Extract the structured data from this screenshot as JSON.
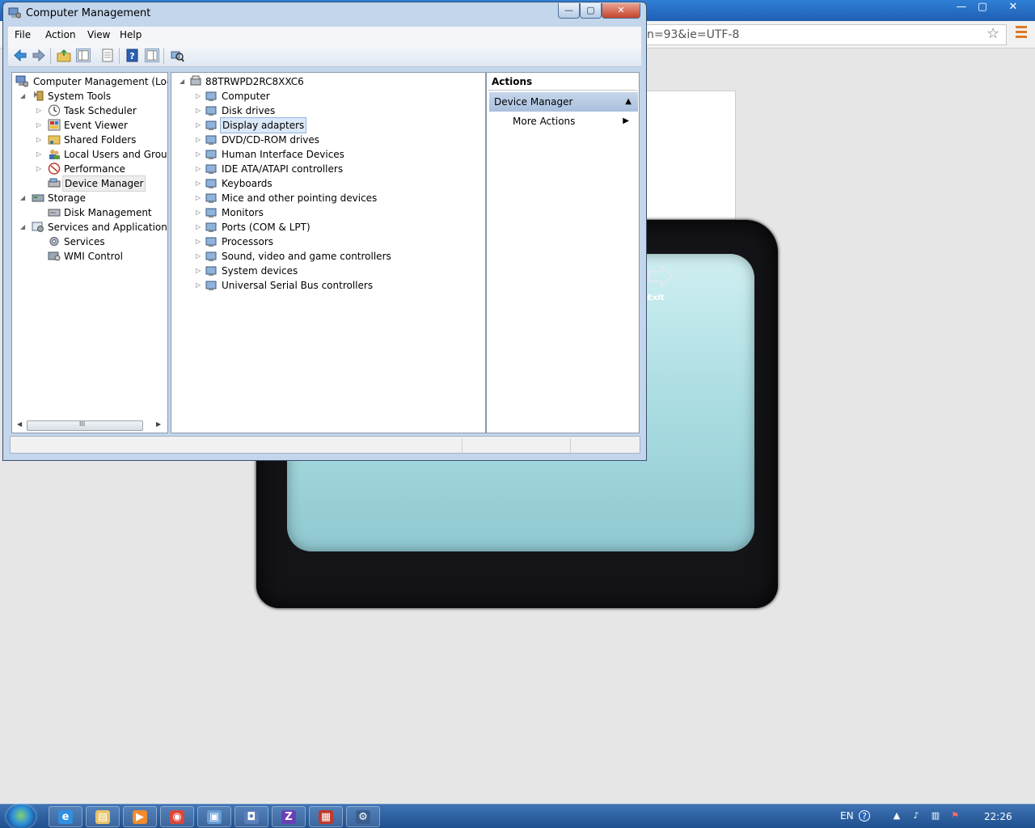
{
  "browser": {
    "address_text": "n=93&ie=UTF-8",
    "minimize_glyph": "—",
    "restore_glyph": "▢",
    "close_glyph": "✕",
    "bookmark_glyph": "☆",
    "exit_label": "Exit"
  },
  "window": {
    "title": "Computer Management",
    "minimize_glyph": "—",
    "maximize_glyph": "▢",
    "close_glyph": "✕"
  },
  "menu": [
    "File",
    "Action",
    "View",
    "Help"
  ],
  "toolbar_icons": [
    "back-icon",
    "forward-icon",
    "up-folder-icon",
    "show-hide-tree-icon",
    "properties-icon",
    "help-icon",
    "show-hide-action-pane-icon",
    "scan-hardware-icon"
  ],
  "left_tree": [
    {
      "label": "Computer Management (Local",
      "icon": "computer-management-icon",
      "tri": ""
    },
    {
      "label": "System Tools",
      "icon": "system-tools-icon",
      "tri": "◢"
    },
    {
      "label": "Task Scheduler",
      "icon": "clock-icon",
      "tri": "▷"
    },
    {
      "label": "Event Viewer",
      "icon": "event-viewer-icon",
      "tri": "▷"
    },
    {
      "label": "Shared Folders",
      "icon": "shared-folder-icon",
      "tri": "▷"
    },
    {
      "label": "Local Users and Groups",
      "icon": "users-icon",
      "tri": "▷"
    },
    {
      "label": "Performance",
      "icon": "performance-icon",
      "tri": "▷"
    },
    {
      "label": "Device Manager",
      "icon": "device-manager-icon",
      "tri": ""
    },
    {
      "label": "Storage",
      "icon": "storage-icon",
      "tri": "◢"
    },
    {
      "label": "Disk Management",
      "icon": "disk-icon",
      "tri": ""
    },
    {
      "label": "Services and Applications",
      "icon": "services-applications-icon",
      "tri": "◢"
    },
    {
      "label": "Services",
      "icon": "services-gear-icon",
      "tri": ""
    },
    {
      "label": "WMI Control",
      "icon": "wmi-icon",
      "tri": ""
    }
  ],
  "scroll_thumb_glyph": "III",
  "scroll_left_glyph": "◀",
  "scroll_right_glyph": "▶",
  "device_root": "88TRWPD2RC8XXC6",
  "device_categories": [
    {
      "label": "Computer",
      "icon": "computer-icon"
    },
    {
      "label": "Disk drives",
      "icon": "disk-drive-icon"
    },
    {
      "label": "Display adapters",
      "icon": "display-adapter-icon"
    },
    {
      "label": "DVD/CD-ROM drives",
      "icon": "dvd-drive-icon"
    },
    {
      "label": "Human Interface Devices",
      "icon": "hid-icon"
    },
    {
      "label": "IDE ATA/ATAPI controllers",
      "icon": "ide-controller-icon"
    },
    {
      "label": "Keyboards",
      "icon": "keyboard-icon"
    },
    {
      "label": "Mice and other pointing devices",
      "icon": "mouse-icon"
    },
    {
      "label": "Monitors",
      "icon": "monitor-icon"
    },
    {
      "label": "Ports (COM & LPT)",
      "icon": "port-icon"
    },
    {
      "label": "Processors",
      "icon": "processor-icon"
    },
    {
      "label": "Sound, video and game controllers",
      "icon": "speaker-icon"
    },
    {
      "label": "System devices",
      "icon": "system-device-icon"
    },
    {
      "label": "Universal Serial Bus controllers",
      "icon": "usb-icon"
    }
  ],
  "tree_collapsed_glyph": "▷",
  "tree_expanded_glyph": "◢",
  "actions": {
    "header": "Actions",
    "section": "Device Manager",
    "collapse_glyph": "▲",
    "more": "More Actions",
    "more_arrow": "▶"
  },
  "taskbar": {
    "apps": [
      {
        "name": "internet-explorer",
        "glyph": "e",
        "color": "#2f8fe0"
      },
      {
        "name": "windows-explorer",
        "glyph": "▤",
        "color": "#e9c46a"
      },
      {
        "name": "media-player",
        "glyph": "▶",
        "color": "#f18b2c"
      },
      {
        "name": "chrome",
        "glyph": "◉",
        "color": "#d9473b"
      },
      {
        "name": "remote-desktop",
        "glyph": "▣",
        "color": "#6a9fd8"
      },
      {
        "name": "computer-management",
        "glyph": "◘",
        "color": "#5b7fb8"
      },
      {
        "name": "z-app",
        "glyph": "Z",
        "color": "#6a3fb5"
      },
      {
        "name": "network-tool",
        "glyph": "▦",
        "color": "#c0392b"
      },
      {
        "name": "device-tool",
        "glyph": "⚙",
        "color": "#3a5f8f"
      }
    ],
    "language": "EN",
    "help_glyph": "?",
    "show_hidden_glyph": "▲",
    "volume_glyph": "♪",
    "network_glyph": "▥",
    "flag_glyph": "⚑",
    "clock": "22:26"
  }
}
